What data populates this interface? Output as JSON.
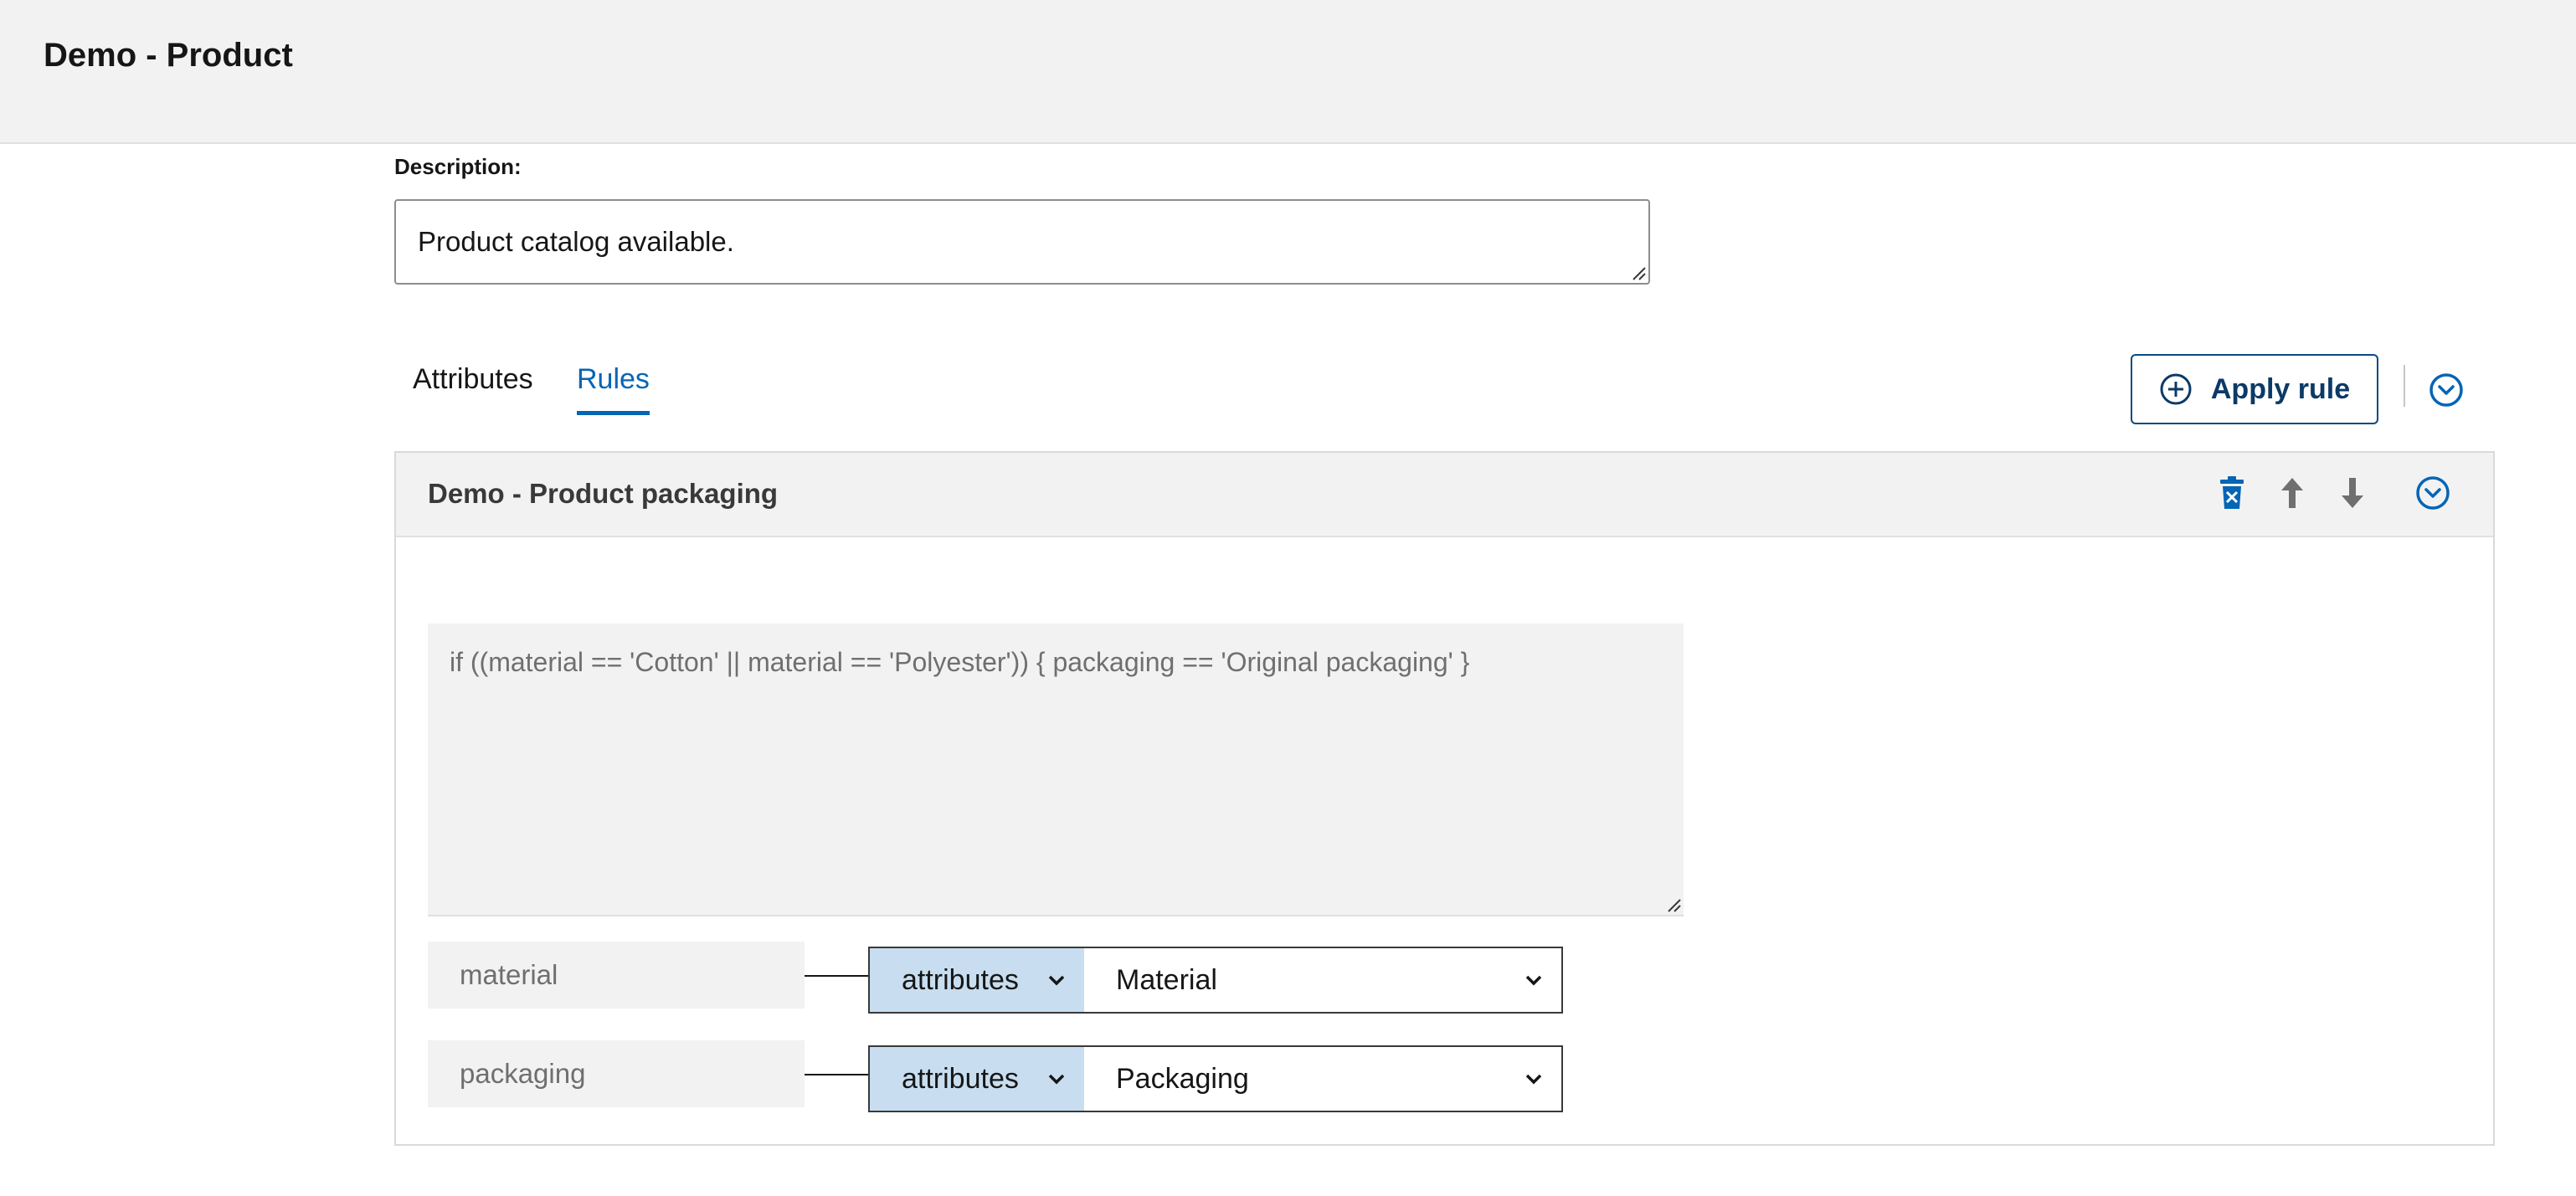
{
  "header": {
    "title": "Demo - Product"
  },
  "description": {
    "label": "Description:",
    "value": "Product catalog available."
  },
  "tabs": [
    {
      "label": "Attributes",
      "active": false
    },
    {
      "label": "Rules",
      "active": true
    }
  ],
  "toolbar": {
    "apply_rule_label": "Apply rule",
    "apply_rule_icon": "plus-circle-icon",
    "collapse_all_icon": "chevron-down-circle-icon"
  },
  "rule": {
    "title": "Demo - Product packaging",
    "actions": [
      {
        "name": "delete",
        "icon": "trash-icon"
      },
      {
        "name": "move-up",
        "icon": "arrow-up-icon"
      },
      {
        "name": "move-down",
        "icon": "arrow-down-icon"
      },
      {
        "name": "collapse",
        "icon": "chevron-down-circle-icon"
      }
    ],
    "expression": "if ((material == 'Cotton' || material == 'Polyester')) { packaging == 'Original packaging' }",
    "mappings": [
      {
        "variable": "material",
        "source": "attributes",
        "value": "Material"
      },
      {
        "variable": "packaging",
        "source": "attributes",
        "value": "Packaging"
      }
    ]
  },
  "colors": {
    "accent": "#0565b5",
    "button_border": "#0b4a80",
    "header_bg": "#f2f2f2",
    "source_select_bg": "#c8def0"
  }
}
